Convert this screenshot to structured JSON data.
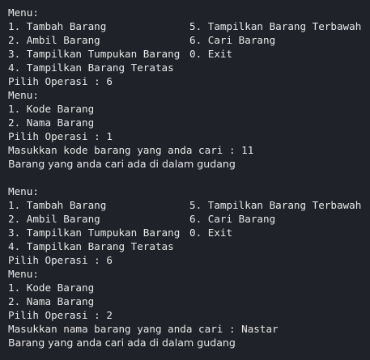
{
  "session1": {
    "menu_label": "Menu:",
    "menu_rows": [
      {
        "left": "1. Tambah Barang",
        "right": "5. Tampilkan Barang Terbawah"
      },
      {
        "left": "2. Ambil Barang",
        "right": "6. Cari Barang"
      },
      {
        "left": "3. Tampilkan Tumpukan Barang",
        "right": "0. Exit"
      }
    ],
    "menu_row4": "4. Tampilkan Barang Teratas",
    "prompt1": "Pilih Operasi : 6",
    "submenu_label": "Menu:",
    "submenu_item1": "1. Kode Barang",
    "submenu_item2": "2. Nama Barang",
    "prompt2": "Pilih Operasi : 1",
    "input_line": "Masukkan kode barang yang anda cari : 11",
    "result": "Barang yang anda cari ada di dalam gudang"
  },
  "session2": {
    "menu_label": "Menu:",
    "menu_rows": [
      {
        "left": "1. Tambah Barang",
        "right": "5. Tampilkan Barang Terbawah"
      },
      {
        "left": "2. Ambil Barang",
        "right": "6. Cari Barang"
      },
      {
        "left": "3. Tampilkan Tumpukan Barang",
        "right": "0. Exit"
      }
    ],
    "menu_row4": "4. Tampilkan Barang Teratas",
    "prompt1": "Pilih Operasi : 6",
    "submenu_label": "Menu:",
    "submenu_item1": "1. Kode Barang",
    "submenu_item2": "2. Nama Barang",
    "prompt2": "Pilih Operasi : 2",
    "input_line": "Masukkan nama barang yang anda cari : Nastar",
    "result": "Barang yang anda cari ada di dalam gudang"
  }
}
